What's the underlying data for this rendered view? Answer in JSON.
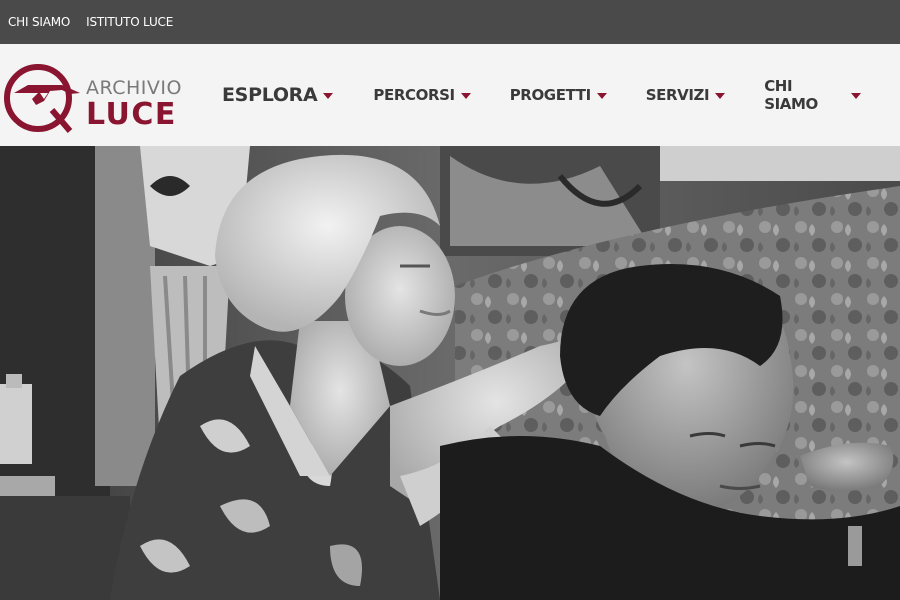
{
  "topbar": {
    "links": [
      "CHI SIAMO",
      "ISTITUTO LUCE"
    ]
  },
  "logo": {
    "line1": "ARCHIVIO",
    "line2": "LUCE",
    "icon": "archivio-luce-emblem-icon",
    "brand_color": "#8a1530"
  },
  "nav": {
    "items": [
      {
        "label": "ESPLORA"
      },
      {
        "label": "PERCORSI"
      },
      {
        "label": "PROGETTI"
      },
      {
        "label": "SERVIZI"
      },
      {
        "label": "CHI SIAMO"
      }
    ],
    "caret_icon": "caret-down-icon",
    "accent_color": "#8a1530"
  },
  "hero": {
    "image": "black-and-white-film-still"
  },
  "colors": {
    "topbar_bg": "#4a4a4a",
    "header_bg": "#f4f4f4",
    "nav_text": "#3a3a3a"
  }
}
